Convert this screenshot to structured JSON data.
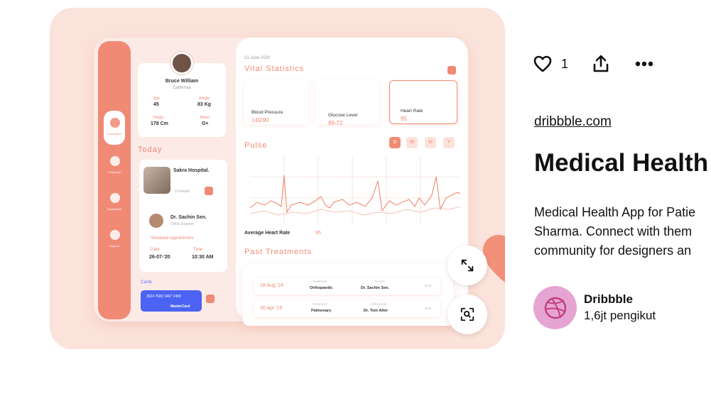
{
  "pin": {
    "likes": "1",
    "source": "dribbble.com",
    "title": "Medical Health",
    "description_lines": [
      "Medical Health App for Patie",
      "Sharma. Connect with them",
      "community for designers an"
    ],
    "creator": {
      "name": "Dribbble",
      "followers": "1,6jt pengikut"
    }
  },
  "icons": {
    "like": "heart-outline-icon",
    "share": "share-upload-icon",
    "more": "more-dots-icon",
    "expand": "expand-arrows-icon",
    "visual_search": "lens-search-icon",
    "creator_logo": "dribbble-ball-icon"
  },
  "colors": {
    "accent": "#f08a75",
    "image_bg": "#fbe3db",
    "card_blue": "#4b62f2",
    "creator_avatar": "#e6a4d2"
  },
  "mockup": {
    "sidebar": [
      "Dashboard",
      "Prognosis",
      "Transaction",
      "Support"
    ],
    "profile": {
      "name": "Bruce William",
      "location": "California",
      "age_label": "Age",
      "age": "45",
      "weight_label": "Weight",
      "weight": "83 Kg",
      "height_label": "Height",
      "height": "178 Cm",
      "blood_label": "Blood",
      "blood": "O+"
    },
    "today": "Today",
    "hospital": "Sakra Hospital.",
    "hospital_time": "9 minutes",
    "doctor": "Dr. Sachin Sen.",
    "doctor_role": "Ortho Surgeon",
    "appointment_label": "Sheduled Appointment",
    "date_label": "Date",
    "date": "26-07-'20",
    "time_label": "Time",
    "time": "10:30 AM",
    "cards_label": "Cards",
    "card_number": "3524  7682  3467  2489",
    "card_brand": "MasterCard",
    "header_date": "21 June 2020",
    "vital_title": "Vital Statistics",
    "vitals": [
      {
        "name": "Blood Pressure",
        "value": "140/90"
      },
      {
        "name": "Glucose Level",
        "value": "89-72"
      },
      {
        "name": "Heart Rate",
        "value": "95"
      }
    ],
    "pulse_title": "Pulse",
    "ranges": [
      "D",
      "W",
      "M",
      "Y"
    ],
    "avg_label": "Average Heart Rate",
    "avg_value": "95",
    "past_title": "Past Treatments",
    "treatments": [
      {
        "date": "18 Aug '18",
        "treatment_label": "Treatment",
        "treatment": "Orthopaedic",
        "doctor_label": "Doctor",
        "doctor": "Dr. Sachin Sen.",
        "note": "Note"
      },
      {
        "date": "30 Apr '19",
        "treatment_label": "Treatment",
        "treatment": "Palmonary",
        "doctor_label": "Orthopedic",
        "doctor": "Dr. Tom Alter",
        "note": "Note"
      }
    ]
  }
}
